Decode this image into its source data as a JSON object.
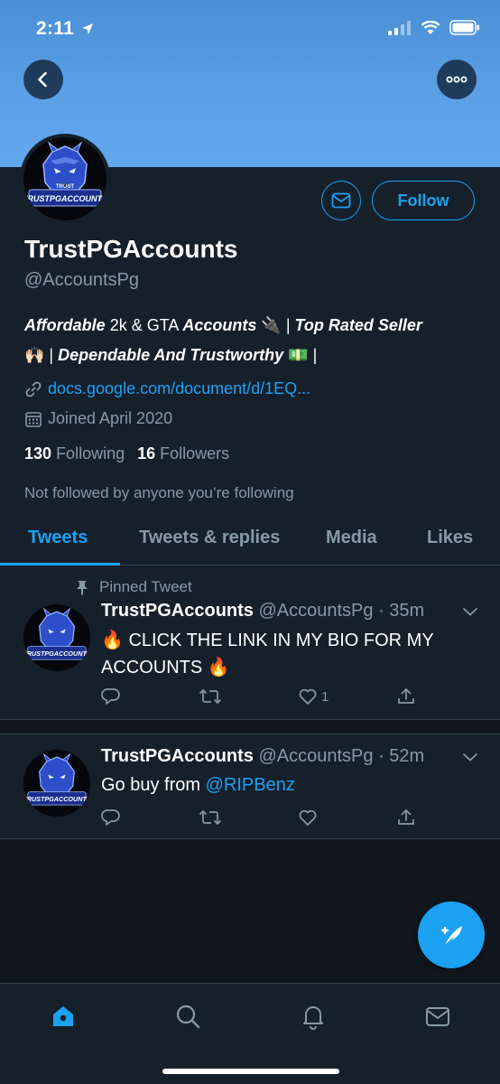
{
  "status_bar": {
    "time": "2:11"
  },
  "profile": {
    "display_name": "TrustPGAccounts",
    "handle": "@AccountsPg",
    "avatar_text_top": "TRUST",
    "avatar_text_main": "TRUSTPGACCOUNTS",
    "follow_label": "Follow",
    "bio": {
      "p1": "Affordable",
      "p2": " 2k & GTA ",
      "p3": "Accounts",
      "e1": "🔌",
      "p4": " | ",
      "p5": "Top Rated Seller",
      "e2": "🙌🏻",
      "p6": " | ",
      "p7": "Dependable And Trustworthy",
      "e3": "💵",
      "p8": " |"
    },
    "link": "docs.google.com/document/d/1EQ...",
    "joined": "Joined April 2020",
    "following_count": "130",
    "following_label": "Following",
    "followers_count": "16",
    "followers_label": "Followers",
    "not_followed": "Not followed by anyone you’re following"
  },
  "tabs": [
    {
      "label": "Tweets",
      "active": true
    },
    {
      "label": "Tweets & replies"
    },
    {
      "label": "Media"
    },
    {
      "label": "Likes"
    }
  ],
  "tweets": [
    {
      "pinned_label": "Pinned Tweet",
      "name": "TrustPGAccounts",
      "handle": "@AccountsPg",
      "time": "· 35m",
      "emoji_start": "🔥",
      "text": " CLICK THE LINK IN MY BIO FOR MY ACCOUNTS ",
      "emoji_end": "🔥",
      "likes": "1"
    },
    {
      "name": "TrustPGAccounts",
      "handle": "@AccountsPg",
      "time": "· 52m",
      "text": "Go buy from ",
      "mention": "@RIPBenz"
    }
  ],
  "colors": {
    "accent": "#1da1f2",
    "background": "#15202b",
    "secondary_text": "#8899a6",
    "banner": "#5b9fe6"
  },
  "icons": [
    "back-icon",
    "more-icon",
    "mail-icon",
    "link-icon",
    "calendar-icon",
    "pin-icon",
    "reply-icon",
    "retweet-icon",
    "like-icon",
    "share-icon",
    "caret-down-icon",
    "compose-icon",
    "home-icon",
    "search-icon",
    "notifications-icon",
    "messages-icon"
  ]
}
